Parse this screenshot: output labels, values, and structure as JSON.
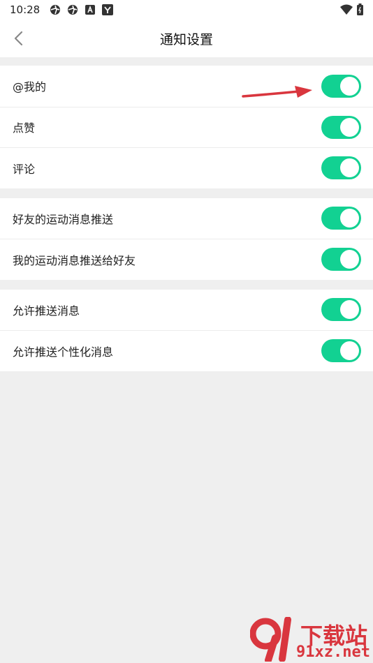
{
  "status_bar": {
    "time": "10:28",
    "icons": [
      "aperture-icon",
      "aperture-icon",
      "a-letter-icon",
      "y-letter-icon"
    ],
    "right_icons": [
      "wifi-icon",
      "battery-icon"
    ]
  },
  "header": {
    "title": "通知设置",
    "back_icon": "chevron-left-icon"
  },
  "groups": [
    {
      "items": [
        {
          "label": "@我的",
          "enabled": true
        },
        {
          "label": "点赞",
          "enabled": true
        },
        {
          "label": "评论",
          "enabled": true
        }
      ]
    },
    {
      "items": [
        {
          "label": "好友的运动消息推送",
          "enabled": true
        },
        {
          "label": "我的运动消息推送给好友",
          "enabled": true
        }
      ]
    },
    {
      "items": [
        {
          "label": "允许推送消息",
          "enabled": true
        },
        {
          "label": "允许推送个性化消息",
          "enabled": true
        }
      ]
    }
  ],
  "colors": {
    "toggle_on": "#12d192",
    "arrow": "#d9363e",
    "background": "#efefef"
  },
  "watermark": {
    "brand": "下载站",
    "domain": "91xz.net"
  }
}
